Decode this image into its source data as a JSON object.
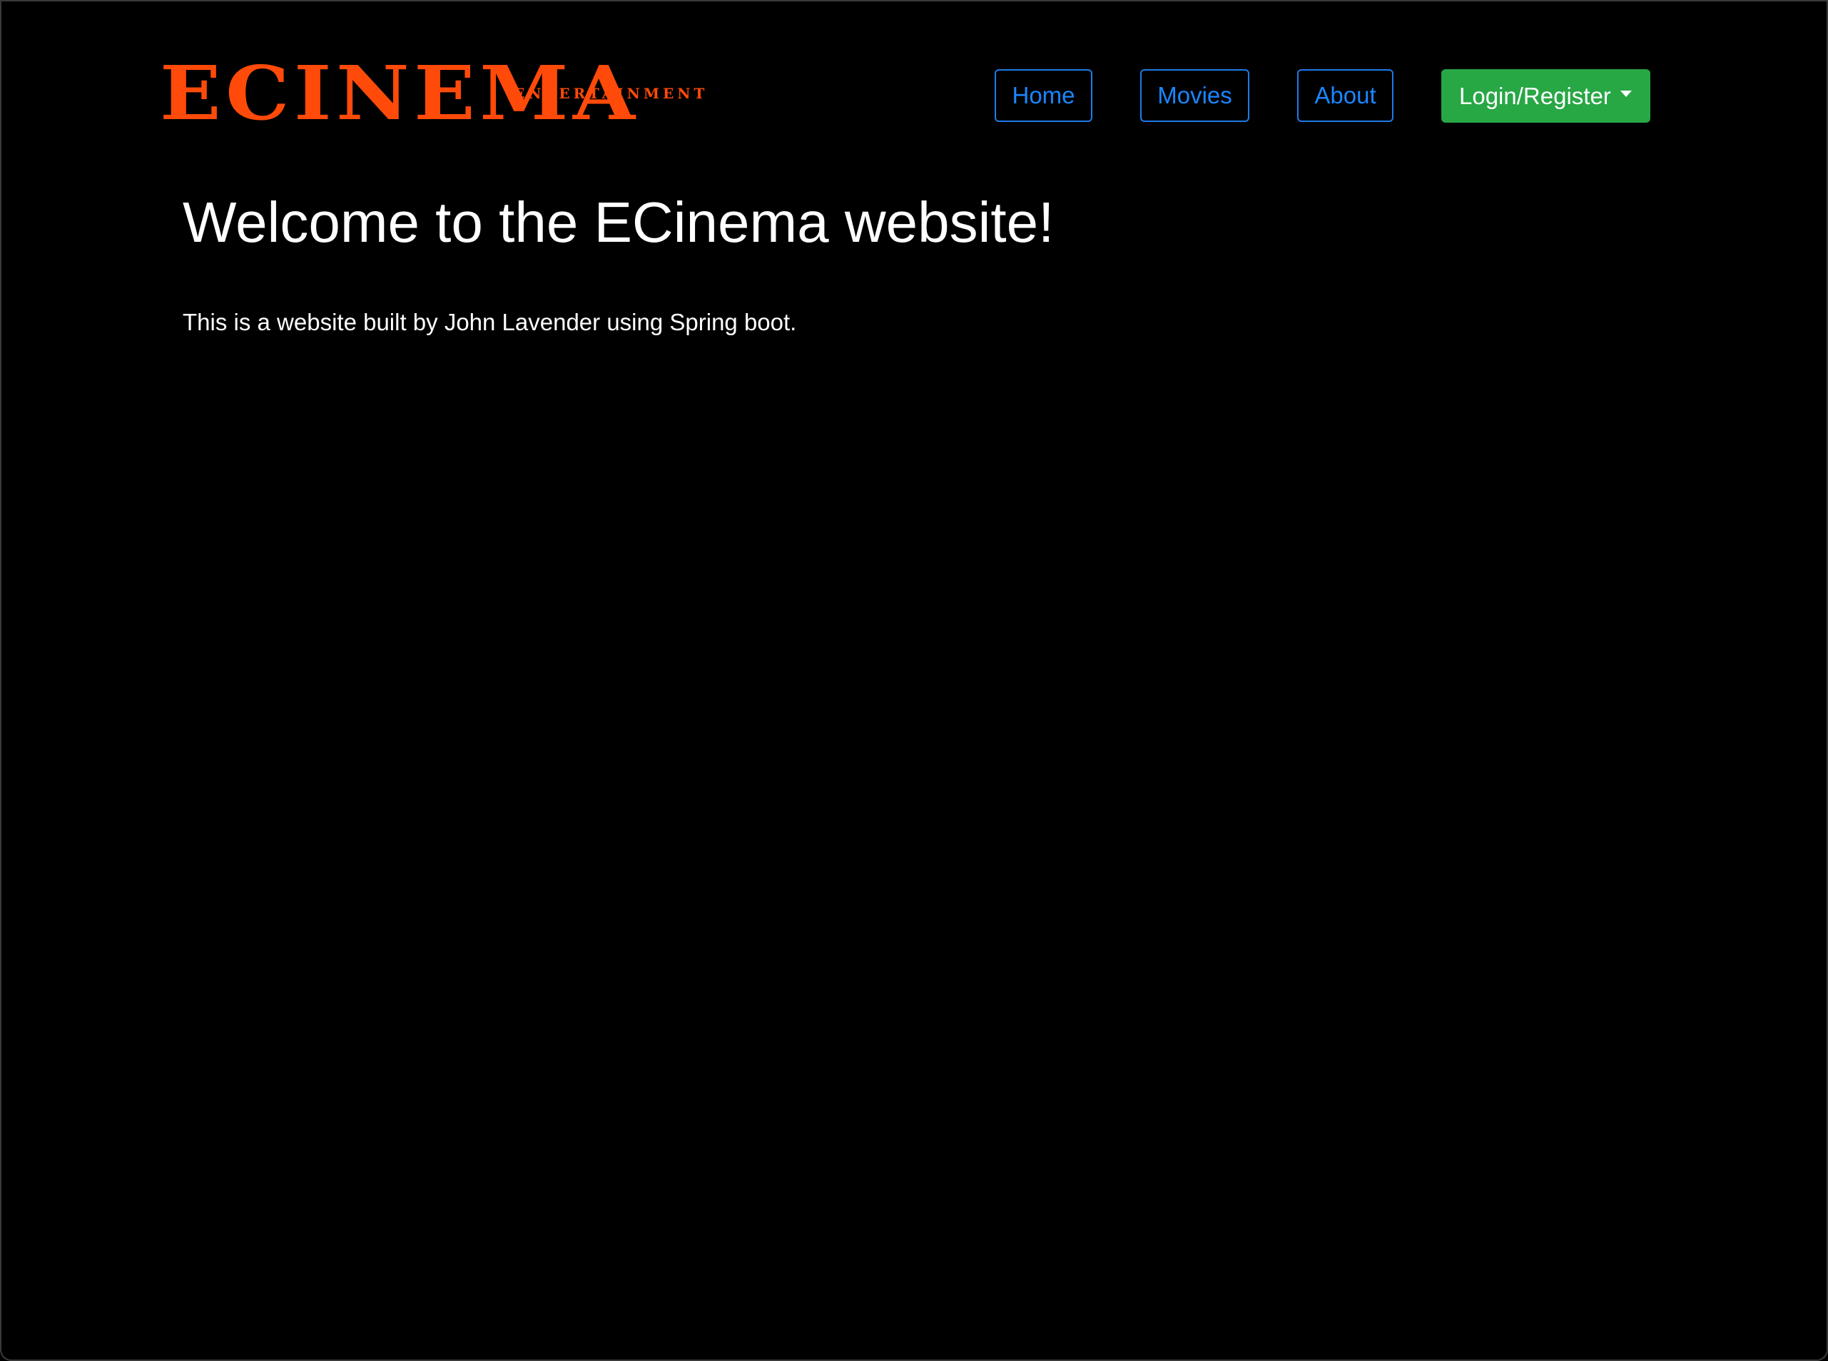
{
  "brand": {
    "name": "ECINEMA",
    "tagline": "ENTERTAINMENT",
    "color": "#ff4a0a"
  },
  "nav": {
    "home": "Home",
    "movies": "Movies",
    "about": "About",
    "login": "Login/Register",
    "link_color": "#1a86ff",
    "login_color": "#28a745"
  },
  "main": {
    "title": "Welcome to the ECinema website!",
    "text": "This is a website built by John Lavender using Spring boot."
  }
}
